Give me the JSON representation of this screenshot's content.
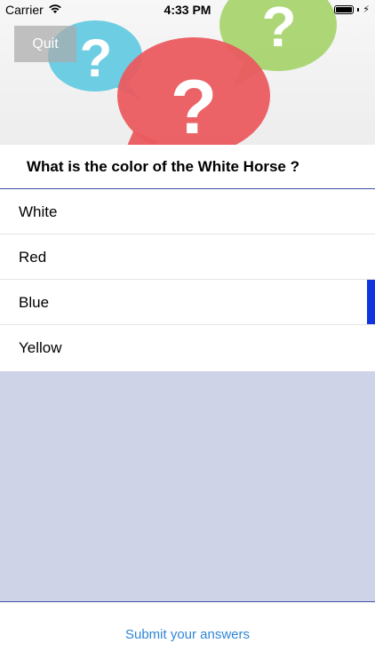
{
  "status_bar": {
    "carrier": "Carrier",
    "time": "4:33 PM",
    "icons": [
      "wifi-icon",
      "battery-icon",
      "charging-bolt-icon"
    ]
  },
  "header": {
    "quit_label": "Quit",
    "image": "question-bubbles-illustration"
  },
  "question": {
    "text": "What is the color of the White Horse ?"
  },
  "options": [
    {
      "label": "White",
      "selected": false
    },
    {
      "label": "Red",
      "selected": false
    },
    {
      "label": "Blue",
      "selected": true
    },
    {
      "label": "Yellow",
      "selected": false
    }
  ],
  "footer": {
    "submit_label": "Submit your answers"
  },
  "colors": {
    "accent_link": "#2f86d6",
    "selection_marker": "#1234e0",
    "divider": "#3f4fa8",
    "empty_area": "#cfd3e8"
  }
}
